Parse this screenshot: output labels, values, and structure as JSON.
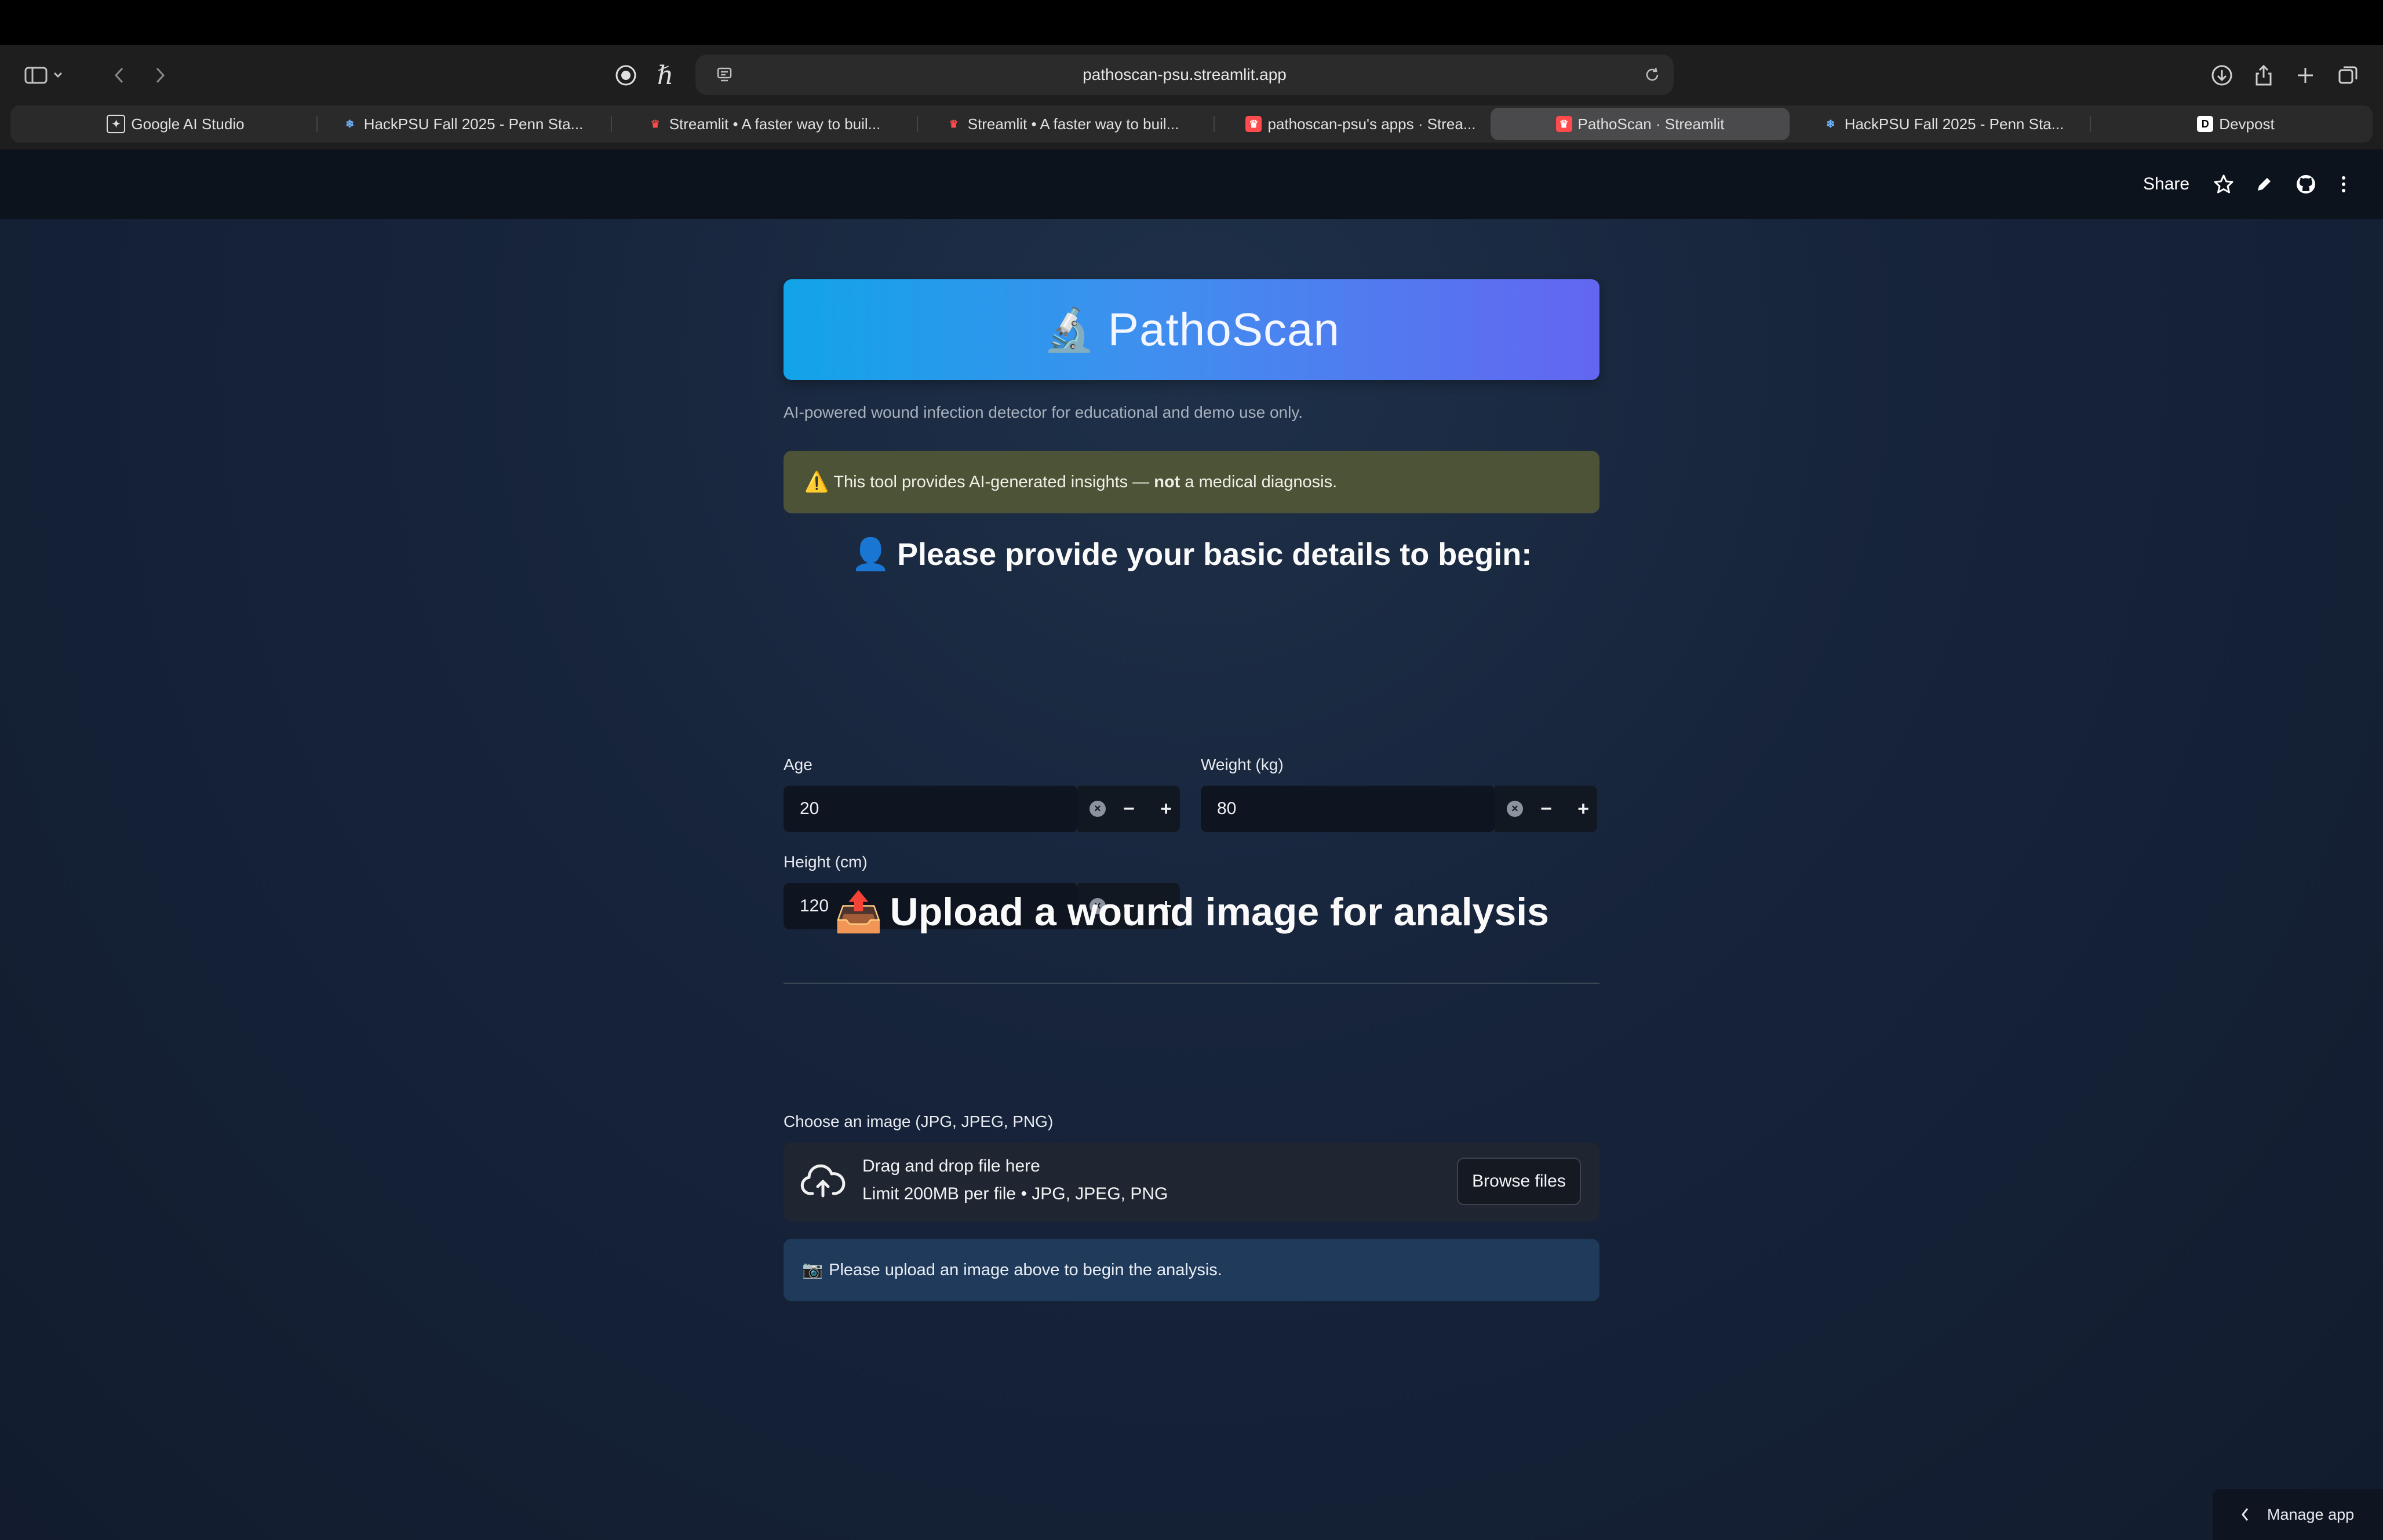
{
  "browser": {
    "url": "pathoscan-psu.streamlit.app",
    "tabs": [
      {
        "label": "Google AI Studio",
        "icon": "ai-studio-icon",
        "active": false
      },
      {
        "label": "HackPSU Fall 2025 - Penn Sta...",
        "icon": "hackpsu-icon",
        "active": false
      },
      {
        "label": "Streamlit • A faster way to buil...",
        "icon": "streamlit-icon",
        "active": false
      },
      {
        "label": "Streamlit • A faster way to buil...",
        "icon": "streamlit-icon",
        "active": false
      },
      {
        "label": "pathoscan-psu's apps · Strea...",
        "icon": "streamlit-icon",
        "active": false
      },
      {
        "label": "PathoScan · Streamlit",
        "icon": "streamlit-icon",
        "active": true
      },
      {
        "label": "HackPSU Fall 2025 - Penn Sta...",
        "icon": "hackpsu-icon",
        "active": false
      },
      {
        "label": "Devpost",
        "icon": "devpost-icon",
        "active": false
      }
    ]
  },
  "header": {
    "share_label": "Share"
  },
  "hero": {
    "emoji": "🔬",
    "title": "PathoScan"
  },
  "caption": "AI-powered wound infection detector for educational and demo use only.",
  "warning": {
    "icon": "⚠️",
    "prefix": "This tool provides AI-generated insights — ",
    "bold": "not",
    "suffix": " a medical diagnosis."
  },
  "details": {
    "heading_emoji": "👤",
    "heading": "Please provide your basic details to begin:",
    "age": {
      "label": "Age",
      "value": "20"
    },
    "weight": {
      "label": "Weight (kg)",
      "value": "80"
    },
    "height": {
      "label": "Height (cm)",
      "value": "120"
    }
  },
  "upload": {
    "heading_emoji": "📤",
    "heading": "Upload a wound image for analysis",
    "label": "Choose an image (JPG, JPEG, PNG)",
    "drag_text": "Drag and drop file here",
    "limit_text": "Limit 200MB per file • JPG, JPEG, PNG",
    "browse_label": "Browse files"
  },
  "info": {
    "emoji": "📷",
    "text": "Please upload an image above to begin the analysis."
  },
  "manage_app": "Manage app"
}
